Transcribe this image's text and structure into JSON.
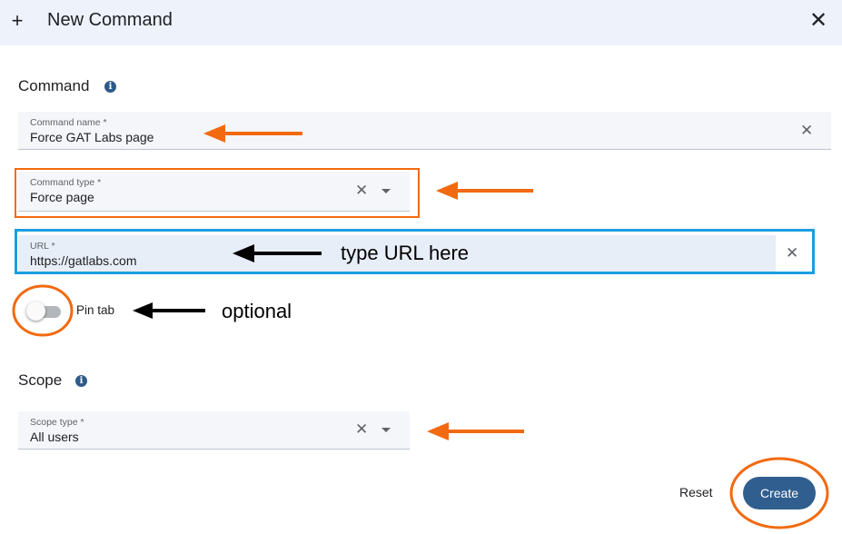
{
  "dialog": {
    "title": "New Command",
    "plus_icon": "plus-icon",
    "close_icon": "close-icon"
  },
  "command_section": {
    "title": "Command",
    "info_glyph": "i",
    "name_field": {
      "label": "Command name *",
      "value": "Force GAT Labs page"
    },
    "type_field": {
      "label": "Command type *",
      "value": "Force page"
    },
    "url_field": {
      "label": "URL *",
      "value": "https://gatlabs.com"
    }
  },
  "pin_tab": {
    "label": "Pin tab",
    "checked": false
  },
  "scope_section": {
    "title": "Scope",
    "info_glyph": "i",
    "scope_field": {
      "label": "Scope type *",
      "value": "All users"
    }
  },
  "actions": {
    "reset_label": "Reset",
    "create_label": "Create"
  },
  "glyphs": {
    "plus": "+",
    "close": "✕",
    "clear": "✕"
  },
  "annotations": {
    "url_hint": "type URL here",
    "pin_hint": "optional",
    "colors": {
      "orange": "#f26a10",
      "blue": "#1a9fe0",
      "black": "#000000"
    }
  },
  "colors": {
    "header_bg": "#eef2fb",
    "field_bg": "#f4f6fa",
    "primary": "#2f5e8f",
    "info": "#2e5a8a"
  }
}
